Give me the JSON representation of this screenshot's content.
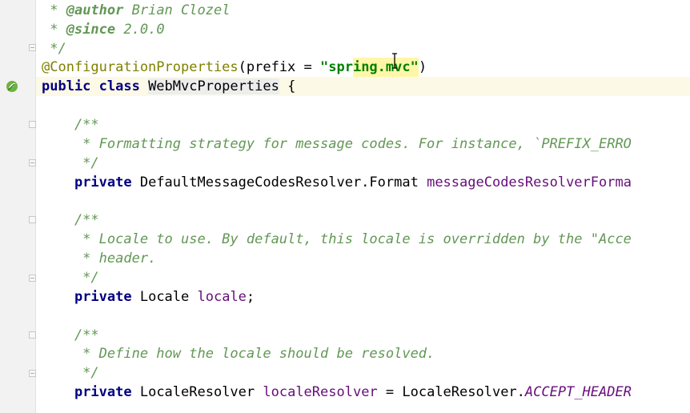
{
  "editor": {
    "lines": {
      "l1": {
        "prefix": " * ",
        "tag": "@author",
        "text": " Brian Clozel"
      },
      "l2": {
        "prefix": " * ",
        "tag": "@since",
        "text": " 2.0.0"
      },
      "l3": {
        "text": " */"
      },
      "l4": {
        "annotation": "@ConfigurationProperties",
        "open": "(prefix = ",
        "str_a": "\"spr",
        "str_b": "ing.mvc\"",
        "close": ")"
      },
      "l5": {
        "kw": "public class ",
        "cls": "WebMvcProperties",
        "rest": " {"
      },
      "l6": {
        "text": "    /**"
      },
      "l7": {
        "text": "     * Formatting strategy for message codes. For instance, `PREFIX_ERRO"
      },
      "l8": {
        "text": "     */"
      },
      "l9": {
        "indent": "    ",
        "kw": "private",
        "type": " DefaultMessageCodesResolver.Format ",
        "field": "messageCodesResolverForma"
      },
      "l10": {
        "text": "    /**"
      },
      "l11": {
        "text": "     * Locale to use. By default, this locale is overridden by the \"Acce"
      },
      "l12": {
        "text": "     * header."
      },
      "l13": {
        "text": "     */"
      },
      "l14": {
        "indent": "    ",
        "kw": "private",
        "type": " Locale ",
        "field": "locale",
        "end": ";"
      },
      "l15": {
        "text": "    /**"
      },
      "l16": {
        "text": "     * Define how the locale should be resolved."
      },
      "l17": {
        "text": "     */"
      },
      "l18": {
        "indent": "    ",
        "kw": "private",
        "type": " LocaleResolver ",
        "field": "localeResolver",
        "mid": " = LocaleResolver.",
        "const": "ACCEPT_HEADER"
      }
    }
  },
  "colors": {
    "keyword": "#000080",
    "doc_comment": "#629755",
    "annotation": "#808000",
    "string": "#008000",
    "field": "#660e7a",
    "current_line": "#fcfae6",
    "gutter": "#f2f2f2"
  },
  "icons": {
    "gutter_bean": "spring-bean-icon",
    "text_cursor": "ibeam-cursor-icon"
  }
}
